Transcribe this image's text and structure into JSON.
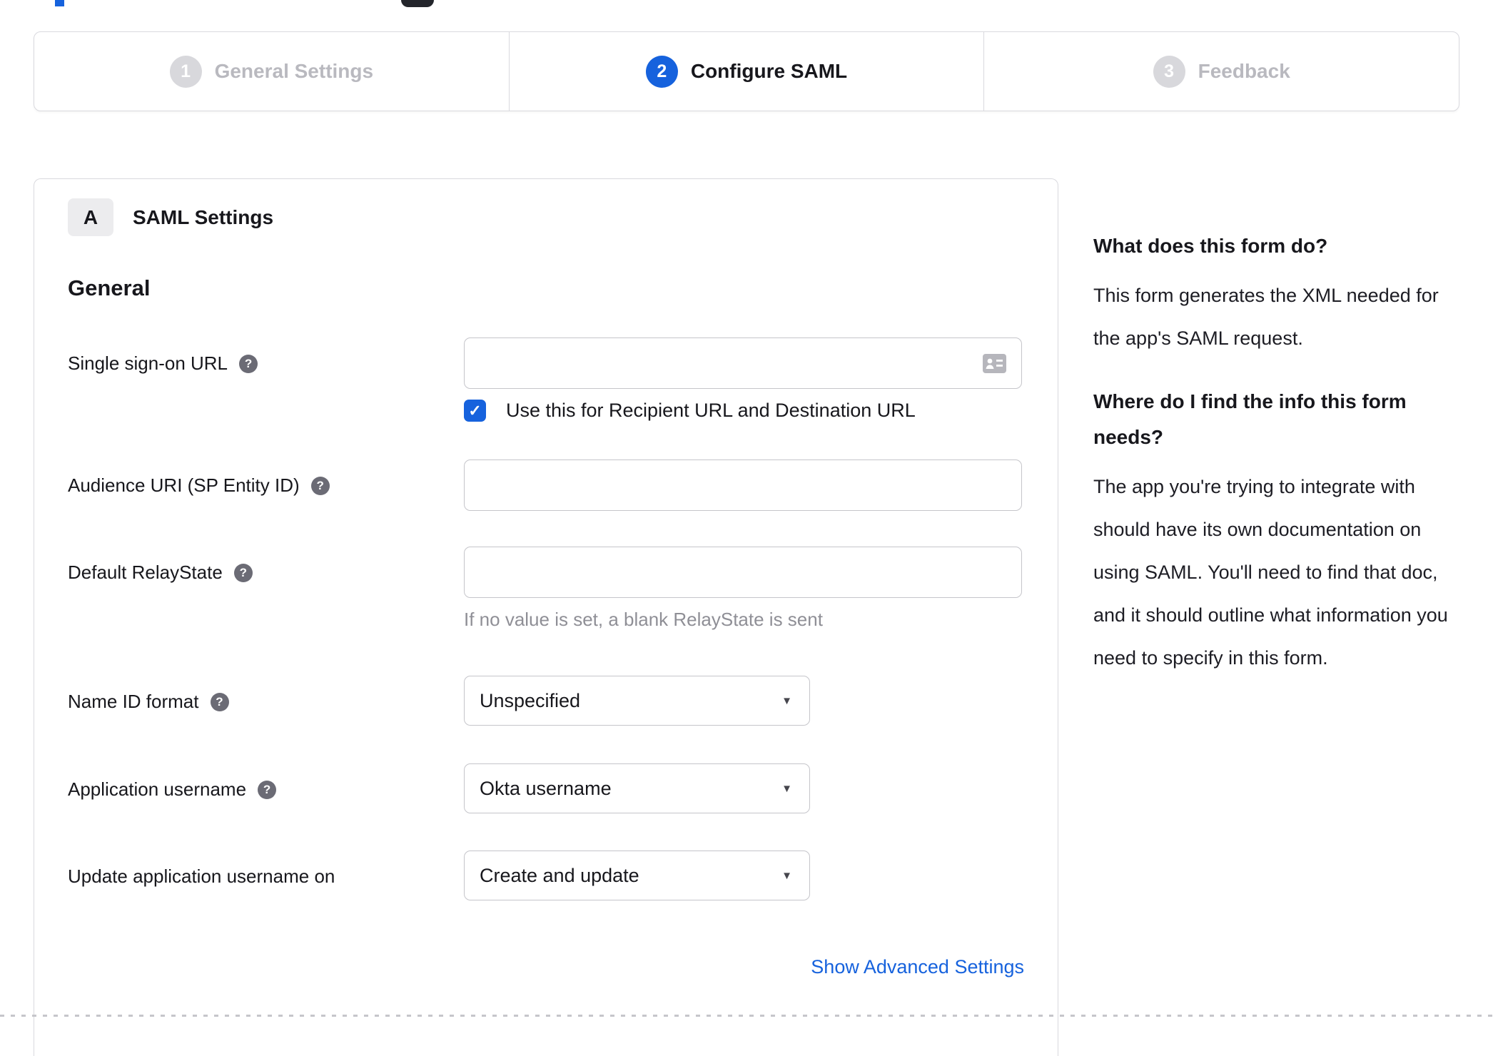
{
  "stepper": {
    "steps": [
      {
        "number": "1",
        "label": "General Settings",
        "active": false
      },
      {
        "number": "2",
        "label": "Configure SAML",
        "active": true
      },
      {
        "number": "3",
        "label": "Feedback",
        "active": false
      }
    ]
  },
  "saml_panel": {
    "section_badge": "A",
    "section_title": "SAML Settings",
    "group_title": "General",
    "rows": [
      {
        "label": "Single sign-on URL",
        "has_help": true,
        "control": "text",
        "value": ""
      },
      {
        "label": "Audience URI (SP Entity ID)",
        "has_help": true,
        "control": "text",
        "value": ""
      },
      {
        "label": "Default RelayState",
        "has_help": true,
        "control": "text",
        "value": "",
        "hint": "If no value is set, a blank RelayState is sent"
      },
      {
        "label": "Name ID format",
        "has_help": true,
        "control": "select",
        "value": "Unspecified"
      },
      {
        "label": "Application username",
        "has_help": true,
        "control": "select",
        "value": "Okta username"
      },
      {
        "label": "Update application username on",
        "has_help": false,
        "control": "select",
        "value": "Create and update"
      }
    ],
    "sso_checkbox": {
      "checked": true,
      "label": "Use this for Recipient URL and Destination URL"
    },
    "advanced_settings_link": "Show Advanced Settings"
  },
  "help_panel": {
    "sections": [
      {
        "heading": "What does this form do?",
        "body": "This form generates the XML needed for the app's SAML request."
      },
      {
        "heading": "Where do I find the info this form needs?",
        "body": "The app you're trying to integrate with should have its own documentation on using SAML. You'll need to find that doc, and it should outline what information you need to specify in this form."
      }
    ]
  },
  "icons": {
    "help": "?",
    "caret": "▼",
    "check": "✓"
  },
  "colors": {
    "accent": "#1662dd",
    "inactive_step": "#d8d8dc",
    "border": "#d9d9de",
    "muted": "#8f8f96"
  }
}
